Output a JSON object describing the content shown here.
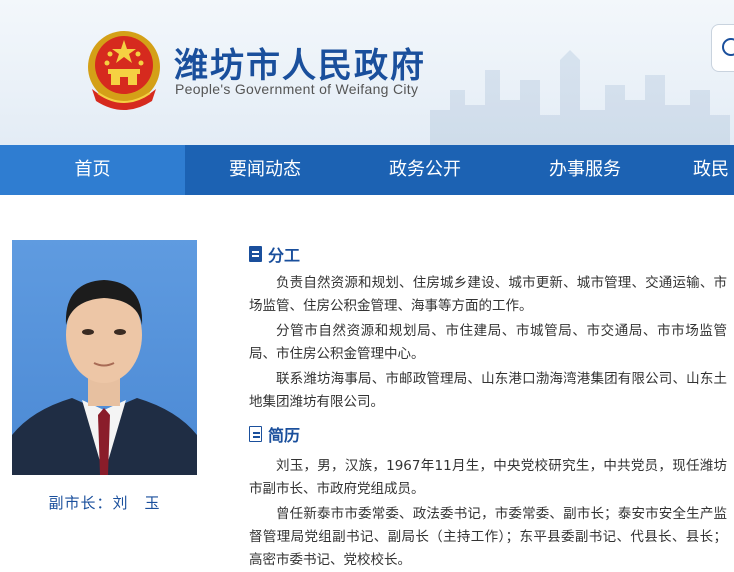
{
  "header": {
    "title": "潍坊市人民政府",
    "subtitle": "People's Government of Weifang City",
    "search_icon": "search-icon",
    "emblem_icon": "national-emblem-icon"
  },
  "nav": {
    "items": [
      "首页",
      "要闻动态",
      "政务公开",
      "办事服务",
      "政民"
    ],
    "active_index": 0,
    "bg_color": "#1c62b3",
    "active_color": "#2f7dd1"
  },
  "profile": {
    "caption": "副市长：刘　玉",
    "duties": {
      "heading": "分工",
      "paragraphs": [
        "负责自然资源和规划、住房城乡建设、城市更新、城市管理、交通运输、市场监管、住房公积金管理、海事等方面的工作。",
        "分管市自然资源和规划局、市住建局、市城管局、市交通局、市市场监管局、市住房公积金管理中心。",
        "联系潍坊海事局、市邮政管理局、山东港口渤海湾港集团有限公司、山东土地集团潍坊有限公司。"
      ]
    },
    "resume": {
      "heading": "简历",
      "paragraphs": [
        "刘玉，男，汉族，1967年11月生，中央党校研究生，中共党员，现任潍坊市副市长、市政府党组成员。",
        "曾任新泰市市委常委、政法委书记，市委常委、副市长；泰安市安全生产监督管理局党组副书记、副局长（主持工作）；东平县委副书记、代县长、县长；高密市委书记、党校校长。"
      ]
    }
  }
}
